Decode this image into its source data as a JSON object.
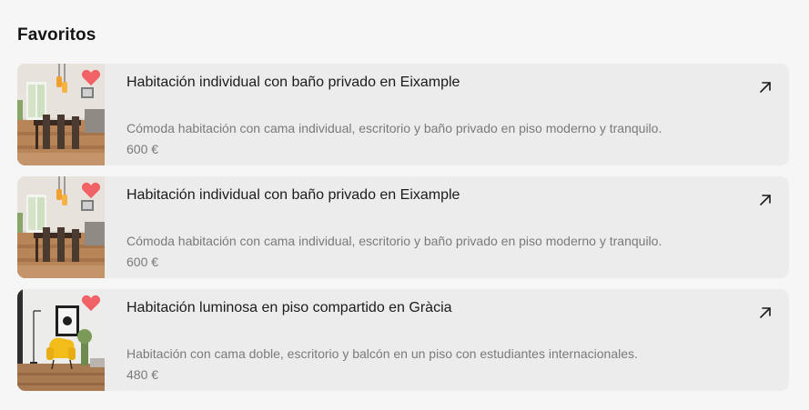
{
  "section": {
    "title": "Favoritos"
  },
  "favorites": [
    {
      "title": "Habitación individual con baño privado en Eixample",
      "description": "Cómoda habitación con cama individual, escritorio y baño privado en piso moderno y tranquilo.",
      "price": "600 €",
      "image_icon": "dining-room-photo",
      "favorite": true
    },
    {
      "title": "Habitación individual con baño privado en Eixample",
      "description": "Cómoda habitación con cama individual, escritorio y baño privado en piso moderno y tranquilo.",
      "price": "600 €",
      "image_icon": "dining-room-photo",
      "favorite": true
    },
    {
      "title": "Habitación luminosa en piso compartido en Gràcia",
      "description": "Habitación con cama doble, escritorio y balcón en un piso con estudiantes internacionales.",
      "price": "480 €",
      "image_icon": "living-room-yellow-chair-photo",
      "favorite": true
    }
  ],
  "colors": {
    "heart": "#f06265",
    "card_bg": "#ececec",
    "page_bg": "#f6f6f6",
    "muted_text": "#7a7a7a"
  }
}
